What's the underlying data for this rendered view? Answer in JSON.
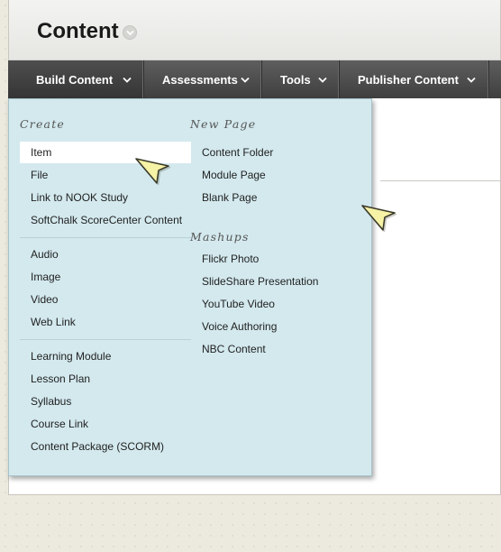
{
  "page": {
    "title": "Content",
    "menu_icon": "chevron-down-circle-icon"
  },
  "nav": {
    "items": [
      {
        "label": "Build Content",
        "icon": "chevron-down-icon"
      },
      {
        "label": "Assessments",
        "icon": "chevron-down-icon"
      },
      {
        "label": "Tools",
        "icon": "chevron-down-icon"
      },
      {
        "label": "Publisher Content",
        "icon": "chevron-down-icon"
      }
    ]
  },
  "dropdown": {
    "create": {
      "title": "Create",
      "items": [
        "Item",
        "File",
        "Link to NOOK Study",
        "SoftChalk ScoreCenter Content"
      ],
      "media_items": [
        "Audio",
        "Image",
        "Video",
        "Web Link"
      ],
      "learning_items": [
        "Learning Module",
        "Lesson Plan",
        "Syllabus",
        "Course Link",
        "Content Package (SCORM)"
      ]
    },
    "new_page": {
      "title": "New Page",
      "items": [
        "Content Folder",
        "Module Page",
        "Blank Page"
      ]
    },
    "mashups": {
      "title": "Mashups",
      "items": [
        "Flickr Photo",
        "SlideShare Presentation",
        "YouTube Video",
        "Voice Authoring",
        "NBC Content"
      ]
    }
  },
  "colors": {
    "nav_bg": "#4a4a4a",
    "dropdown_bg": "#d3e9ee",
    "highlight_bg": "#ffffff",
    "cursor_fill": "#f6f2a6"
  }
}
